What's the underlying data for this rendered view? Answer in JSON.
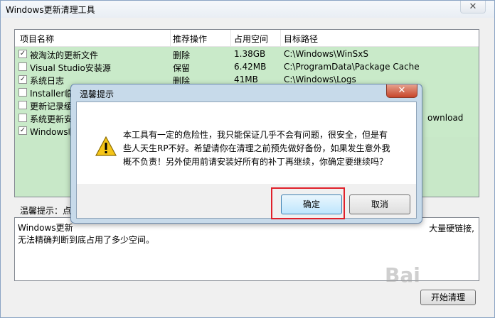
{
  "window": {
    "title": "Windows更新清理工具",
    "close_glyph": "✕"
  },
  "list": {
    "columns": [
      "项目名称",
      "推荐操作",
      "占用空间",
      "目标路径"
    ],
    "rows": [
      {
        "checked": true,
        "name": "被淘汰的更新文件",
        "action": "删除",
        "size": "1.38GB",
        "path": "C:\\Windows\\WinSxS"
      },
      {
        "checked": false,
        "name": "Visual Studio安装源",
        "action": "保留",
        "size": "6.42MB",
        "path": "C:\\ProgramData\\Package Cache"
      },
      {
        "checked": true,
        "name": "系统日志",
        "action": "删除",
        "size": "41MB",
        "path": "C:\\Windows\\Logs"
      },
      {
        "checked": false,
        "name": "Installer临",
        "action": "",
        "size": "",
        "path": ""
      },
      {
        "checked": false,
        "name": "更新记录缓",
        "action": "",
        "size": "",
        "path": ""
      },
      {
        "checked": false,
        "name": "系统更新安",
        "action": "",
        "size": "",
        "path": "ownload"
      },
      {
        "checked": true,
        "name": "Windows临",
        "action": "",
        "size": "",
        "path": ""
      }
    ]
  },
  "tip": {
    "label": "温馨提示：点",
    "text": "Windows更新",
    "text_right": "大量硬链接,",
    "text_line2": "无法精确判断到底占用了多少空间。"
  },
  "start_button": "开始清理",
  "watermark": "Bai",
  "dialog": {
    "title": "温馨提示",
    "message": "本工具有一定的危险性，我只能保证几乎不会有问题，很安全，但是有些人天生RP不好。希望请你在清理之前预先做好备份，如果发生意外我概不负责！另外使用前请安装好所有的补丁再继续，你确定要继续吗？",
    "ok": "确定",
    "cancel": "取消",
    "close_glyph": "✕"
  },
  "colors": {
    "row_bg": "#c9eac9",
    "highlight": "#e0202a"
  }
}
